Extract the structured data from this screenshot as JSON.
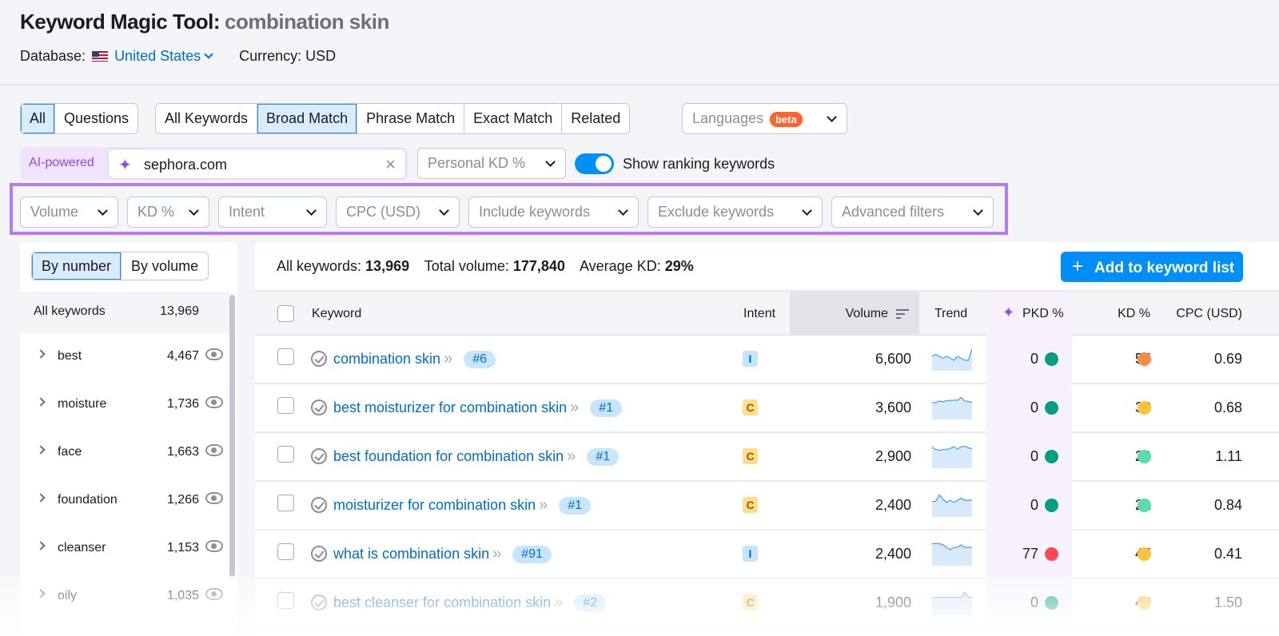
{
  "header": {
    "title": "Keyword Magic Tool:",
    "query": "combination skin",
    "database_label": "Database:",
    "database_value": "United States",
    "currency": "Currency: USD"
  },
  "tabs": {
    "scope": [
      {
        "label": "All",
        "active": true
      },
      {
        "label": "Questions"
      }
    ],
    "match": [
      {
        "label": "All Keywords"
      },
      {
        "label": "Broad Match",
        "active": true
      },
      {
        "label": "Phrase Match"
      },
      {
        "label": "Exact Match"
      },
      {
        "label": "Related"
      }
    ],
    "languages": "Languages",
    "beta": "beta"
  },
  "ai": {
    "label": "AI-powered",
    "value": "sephora.com",
    "personal_kd": "Personal KD %",
    "toggle_on": true,
    "toggle_label": "Show ranking keywords"
  },
  "filters": [
    "Volume",
    "KD %",
    "Intent",
    "CPC (USD)",
    "Include keywords",
    "Exclude keywords",
    "Advanced filters"
  ],
  "sidebar": {
    "by_number": "By number",
    "by_volume": "By volume",
    "all_label": "All keywords",
    "all_count": "13,969",
    "groups": [
      {
        "name": "best",
        "count": "4,467"
      },
      {
        "name": "moisture",
        "count": "1,736"
      },
      {
        "name": "face",
        "count": "1,663"
      },
      {
        "name": "foundation",
        "count": "1,266"
      },
      {
        "name": "cleanser",
        "count": "1,153"
      },
      {
        "name": "oily",
        "count": "1,035"
      }
    ]
  },
  "summary": {
    "all_label": "All keywords:",
    "all": "13,969",
    "vol_label": "Total volume:",
    "vol": "177,840",
    "kd_label": "Average KD:",
    "kd": "29%"
  },
  "add_button": "Add to keyword list",
  "columns": {
    "keyword": "Keyword",
    "intent": "Intent",
    "volume": "Volume",
    "trend": "Trend",
    "pkd": "PKD %",
    "kd": "KD %",
    "cpc": "CPC (USD)"
  },
  "colors": {
    "accent": "#008ff8",
    "ai": "#8d4af0",
    "filter_border": "#b57bf7",
    "kd_green_dark": "#009f81",
    "kd_green": "#59ddaa",
    "kd_yellow": "#fdc23c",
    "kd_orange": "#ff8c43",
    "kd_red": "#ff4953"
  },
  "rows": [
    {
      "keyword": "combination skin",
      "pos": "#6",
      "intent": "I",
      "volume": "6,600",
      "trend": [
        5,
        6,
        5,
        4,
        5,
        4,
        3,
        5,
        4,
        3,
        3,
        9
      ],
      "pkd": "0",
      "pkd_color": "#009f81",
      "kd": "55",
      "kd_color": "#ff8c43",
      "cpc": "0.69"
    },
    {
      "keyword": "best moisturizer for combination skin",
      "pos": "#1",
      "intent": "C",
      "volume": "3,600",
      "trend": [
        3,
        3,
        3.4,
        3.2,
        3.5,
        3.5,
        3.6,
        3.6,
        4.3,
        3.4,
        3.3,
        3
      ],
      "pkd": "0",
      "pkd_color": "#009f81",
      "kd": "33",
      "kd_color": "#fdc23c",
      "cpc": "0.68"
    },
    {
      "keyword": "best foundation for combination skin",
      "pos": "#1",
      "intent": "C",
      "volume": "2,900",
      "trend": [
        3.5,
        3,
        2.8,
        3,
        3,
        3.2,
        3.6,
        3.1,
        3.6,
        3.7,
        3.3,
        3.2
      ],
      "pkd": "0",
      "pkd_color": "#009f81",
      "kd": "29",
      "kd_color": "#59ddaa",
      "cpc": "1.11"
    },
    {
      "keyword": "moisturizer for combination skin",
      "pos": "#1",
      "intent": "C",
      "volume": "2,400",
      "trend": [
        5,
        5,
        8,
        6,
        4.5,
        5.5,
        4.5,
        5.5,
        6.5,
        5.5,
        5.5,
        5.5
      ],
      "pkd": "0",
      "pkd_color": "#009f81",
      "kd": "21",
      "kd_color": "#59ddaa",
      "cpc": "0.84"
    },
    {
      "keyword": "what is combination skin",
      "pos": "#91",
      "intent": "I",
      "volume": "2,400",
      "trend": [
        7,
        7,
        7,
        6.5,
        5.5,
        4.5,
        5.5,
        5.5,
        6.5,
        5.5,
        5.5,
        5.5
      ],
      "pkd": "77",
      "pkd_color": "#ff4953",
      "kd": "45",
      "kd_color": "#fdc23c",
      "cpc": "0.41"
    },
    {
      "keyword": "best cleanser for combination skin",
      "pos": "#2",
      "intent": "C",
      "volume": "1,900",
      "trend": [
        5,
        5,
        5,
        5,
        5,
        5,
        5,
        5,
        5,
        7,
        5,
        5
      ],
      "pkd": "0",
      "pkd_color": "#009f81",
      "kd": "48",
      "kd_color": "#fdc23c",
      "cpc": "1.50"
    }
  ]
}
